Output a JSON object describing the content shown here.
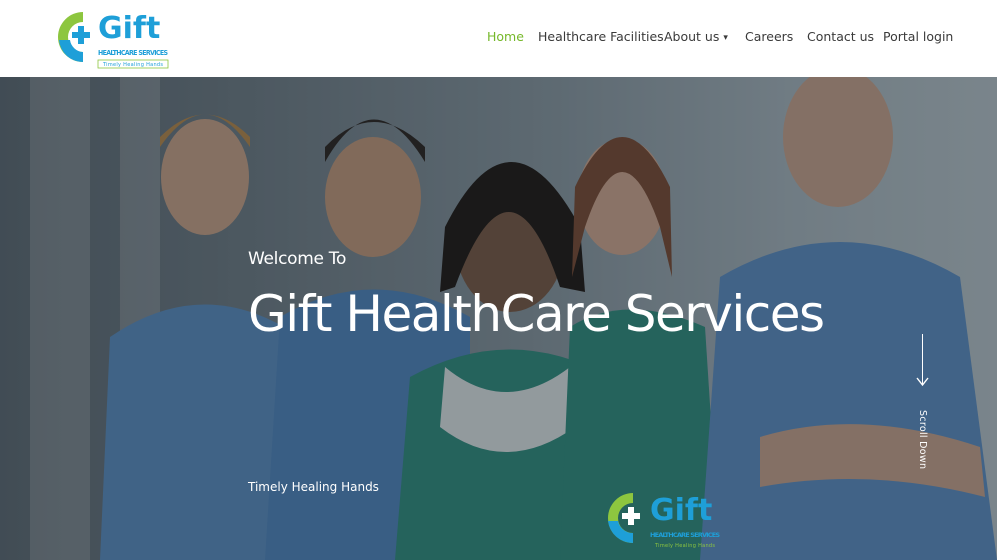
{
  "brand": {
    "name": "Gift",
    "subtitle": "HEALTHCARE SERVICES",
    "motto": "Timely Healing Hands",
    "colors": {
      "green": "#8dc63f",
      "blue": "#1e9fd8",
      "nav_active": "#76b82a"
    }
  },
  "nav": {
    "home": "Home",
    "facilities": "Healthcare Facilities",
    "about": "About us",
    "careers": "Careers",
    "contact": "Contact us",
    "portal": "Portal login",
    "active": "Home"
  },
  "hero": {
    "kicker": "Welcome To",
    "title": "Gift HealthCare Services",
    "tagline": "Timely Healing Hands",
    "scroll_label": "Scroll Down"
  },
  "icons": {
    "logo": "gift-healthcare-logo",
    "scroll": "arrow-down-icon",
    "dropdown": "chevron-down-icon"
  }
}
